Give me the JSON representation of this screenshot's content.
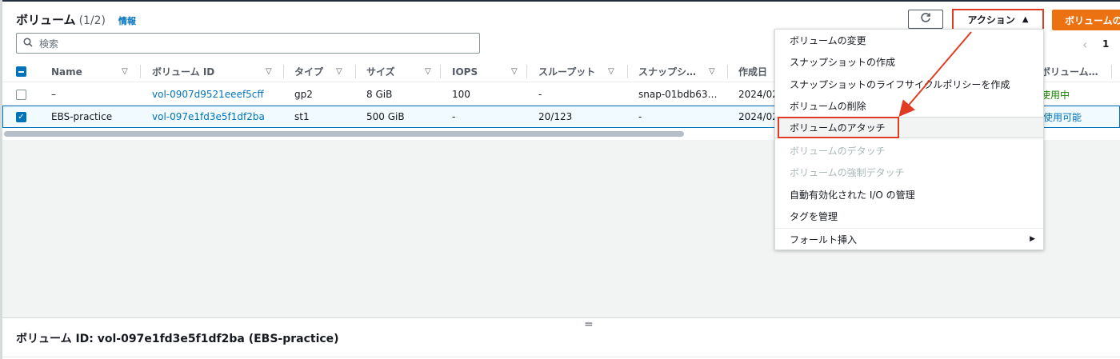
{
  "header": {
    "title": "ボリューム",
    "count": "(1/2)",
    "info_link": "情報"
  },
  "toolbar": {
    "actions_label": "アクション",
    "primary_label": "ボリュームの"
  },
  "search": {
    "placeholder": "検索"
  },
  "pagination": {
    "current_page": "1"
  },
  "table": {
    "columns": [
      "Name",
      "ボリューム ID",
      "タイプ",
      "サイズ",
      "IOPS",
      "スループット",
      "スナップシ…",
      "作成日",
      "ボリューム…"
    ],
    "rows": [
      {
        "name": "–",
        "volume_id": "vol-0907d9521eeef5cff",
        "type": "gp2",
        "size": "8 GiB",
        "iops": "100",
        "throughput": "-",
        "snapshot": "snap-01bdb63…",
        "created": "2024/02",
        "state": "使用中",
        "selected": false
      },
      {
        "name": "EBS-practice",
        "volume_id": "vol-097e1fd3e5f1df2ba",
        "type": "st1",
        "size": "500 GiB",
        "iops": "-",
        "throughput": "20/123",
        "snapshot": "-",
        "created": "2024/02",
        "state": "使用可能",
        "selected": true
      }
    ]
  },
  "actions_menu": {
    "items": [
      {
        "label": "ボリュームの変更",
        "disabled": false
      },
      {
        "label": "スナップショットの作成",
        "disabled": false
      },
      {
        "label": "スナップショットのライフサイクルポリシーを作成",
        "disabled": false
      },
      {
        "label": "ボリュームの削除",
        "disabled": false
      },
      {
        "label": "ボリュームのアタッチ",
        "disabled": false,
        "highlighted": true
      },
      {
        "label": "ボリュームのデタッチ",
        "disabled": true
      },
      {
        "label": "ボリュームの強制デタッチ",
        "disabled": true
      },
      {
        "label": "自動有効化された I/O の管理",
        "disabled": false
      },
      {
        "label": "タグを管理",
        "disabled": false
      },
      {
        "label": "フォールト挿入",
        "disabled": false,
        "submenu": true
      }
    ]
  },
  "details": {
    "drag_handle": "=",
    "title": "ボリューム ID: vol-097e1fd3e5f1df2ba (EBS-practice)"
  },
  "colors": {
    "accent": "#0073bb",
    "primary_button": "#ec7211",
    "annotation": "#e23b24",
    "status_green": "#1d8102"
  },
  "icons": {
    "refresh": "refresh-icon",
    "search": "search-icon",
    "caret_up": "caret-up-icon",
    "sort": "sort-icon",
    "submenu": "caret-right-icon"
  }
}
